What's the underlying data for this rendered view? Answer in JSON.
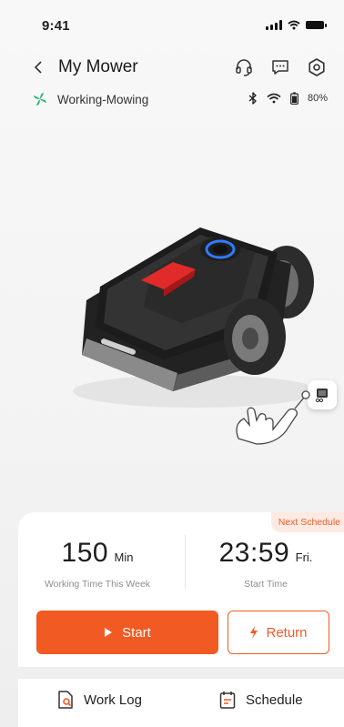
{
  "status_bar": {
    "time": "9:41"
  },
  "header": {
    "title": "My Mower"
  },
  "state": {
    "text": "Working-Mowing",
    "battery": "80%"
  },
  "stats": {
    "week_value": "150",
    "week_unit": "Min",
    "week_label": "Working Time This Week",
    "start_value": "23:59",
    "start_unit": "Fri.",
    "start_label": "Start Time",
    "badge": "Next Schedule"
  },
  "actions": {
    "start_label": "Start",
    "return_label": "Return"
  },
  "nav": {
    "worklog_label": "Work Log",
    "schedule_label": "Schedule"
  },
  "colors": {
    "accent": "#f15a22",
    "status_green": "#2bb673"
  }
}
